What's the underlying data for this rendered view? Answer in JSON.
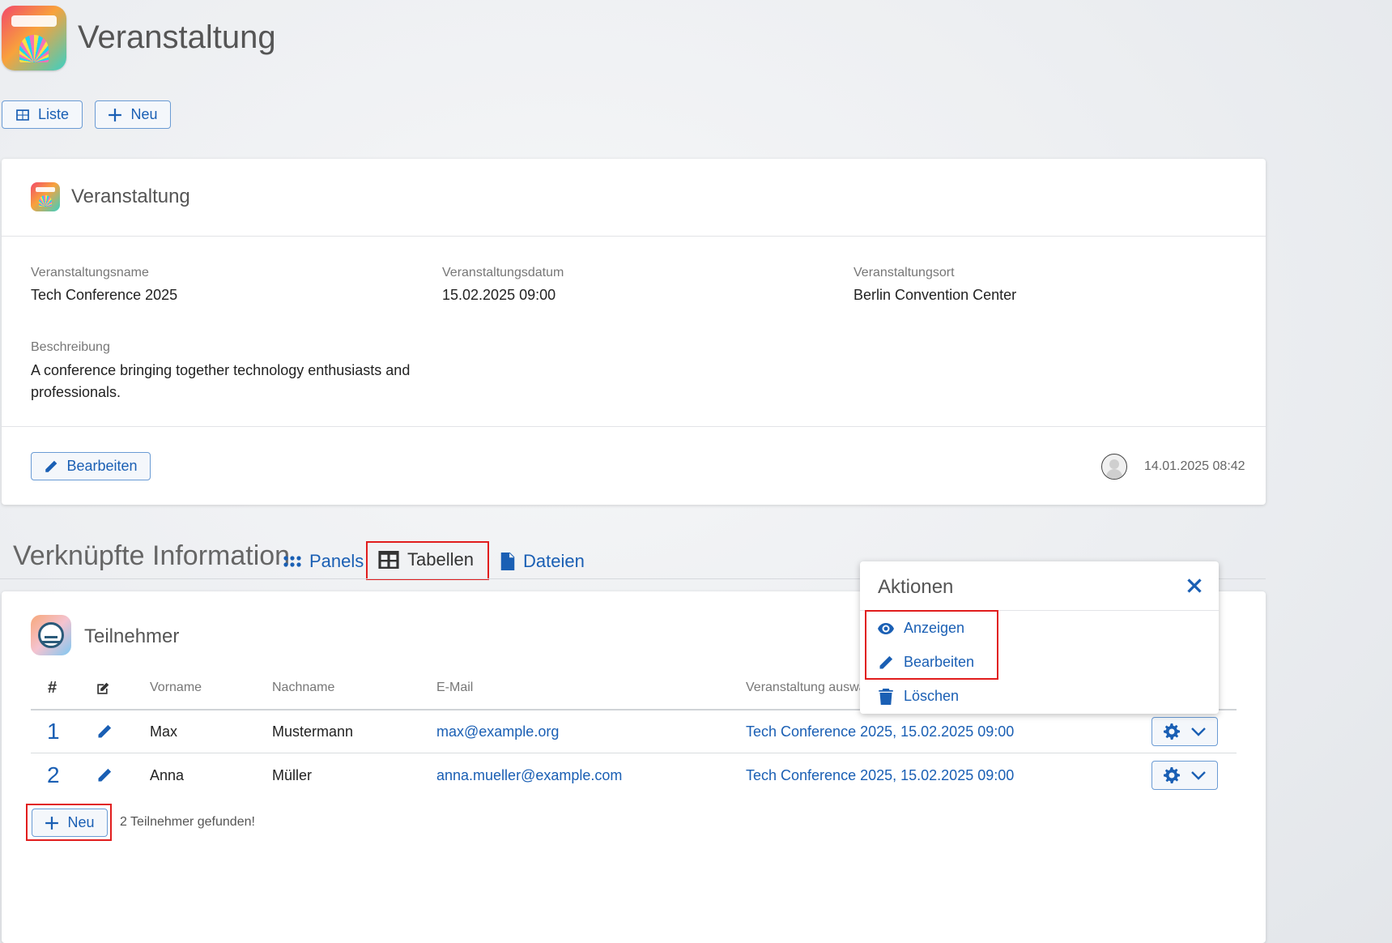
{
  "header": {
    "title": "Veranstaltung",
    "list_label": "Liste",
    "new_label": "Neu"
  },
  "detail": {
    "title": "Veranstaltung",
    "fields": [
      {
        "label": "Veranstaltungsname",
        "value": "Tech Conference 2025"
      },
      {
        "label": "Veranstaltungsdatum",
        "value": "15.02.2025 09:00"
      },
      {
        "label": "Veranstaltungsort",
        "value": "Berlin Convention Center"
      },
      {
        "label": "Beschreibung",
        "value": "A conference bringing together technology enthusiasts and professionals."
      }
    ],
    "edit_label": "Bearbeiten",
    "timestamp": "14.01.2025 08:42"
  },
  "related": {
    "title": "Verknüpfte Information",
    "tabs": [
      {
        "label": "Panels",
        "icon": "grid-icon"
      },
      {
        "label": "Tabellen",
        "icon": "table-icon"
      },
      {
        "label": "Dateien",
        "icon": "file-icon"
      }
    ]
  },
  "participants": {
    "title": "Teilnehmer",
    "columns": [
      "#",
      "",
      "Vorname",
      "Nachname",
      "E-Mail",
      "Veranstaltung auswäh"
    ],
    "rows": [
      {
        "num": "1",
        "first": "Max",
        "last": "Mustermann",
        "email": "max@example.org",
        "event": "Tech Conference 2025, 15.02.2025 09:00"
      },
      {
        "num": "2",
        "first": "Anna",
        "last": "Müller",
        "email": "anna.mueller@example.com",
        "event": "Tech Conference 2025, 15.02.2025 09:00"
      }
    ],
    "new_label": "Neu",
    "found_text": "2 Teilnehmer gefunden!"
  },
  "actions_popover": {
    "title": "Aktionen",
    "items": [
      {
        "label": "Anzeigen",
        "icon": "eye-icon"
      },
      {
        "label": "Bearbeiten",
        "icon": "pencil-icon"
      },
      {
        "label": "Löschen",
        "icon": "trash-icon"
      }
    ]
  },
  "colors": {
    "accent": "#1a5fb4",
    "highlight": "#e11d1d"
  }
}
